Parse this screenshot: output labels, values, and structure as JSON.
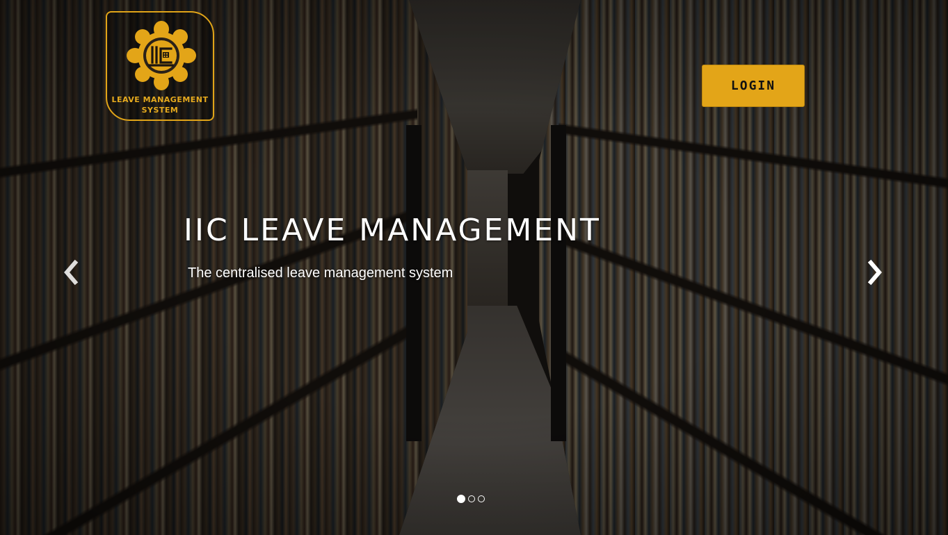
{
  "brand": {
    "logo_line1": "LEAVE MANAGEMENT",
    "logo_line2": "SYSTEM",
    "accent_color": "#e3a518"
  },
  "header": {
    "login_label": "LOGIN"
  },
  "carousel": {
    "title": "IIC LEAVE MANAGEMENT",
    "subtitle": "The centralised leave management system",
    "prev_icon": "chevron-left-icon",
    "next_icon": "chevron-right-icon",
    "slide_count": 3,
    "active_index": 0
  }
}
